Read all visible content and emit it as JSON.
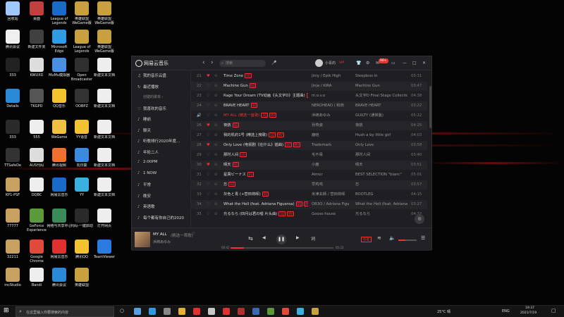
{
  "desktop": {
    "icons": [
      {
        "label": "回收站",
        "color": "#9fc8ff"
      },
      {
        "label": "桌面",
        "color": "#c04040"
      },
      {
        "label": "League of Legends",
        "color": "#1a6ac8"
      },
      {
        "label": "英雄联盟 WeGame版",
        "color": "#c8a040"
      },
      {
        "label": "英雄联盟 WeGame版",
        "color": "#c8a040"
      },
      {
        "label": "腾讯会议",
        "color": "#f0f0f0"
      },
      {
        "label": "新建文件夹",
        "color": "#404040"
      },
      {
        "label": "Microsoft Edge",
        "color": "#2f9be3"
      },
      {
        "label": "League of Legends",
        "color": "#c8a040"
      },
      {
        "label": "英雄联盟 WeGame版",
        "color": "#c8a040"
      },
      {
        "label": "333",
        "color": "#222"
      },
      {
        "label": "KWUXD",
        "color": "#ddd"
      },
      {
        "label": "MuMu模拟器",
        "color": "#4a90e2"
      },
      {
        "label": "Open Broadcaster",
        "color": "#303030"
      },
      {
        "label": "新建文本文档",
        "color": "#eee"
      },
      {
        "label": "Details",
        "color": "#2a8ad8"
      },
      {
        "label": "TKGPD",
        "color": "#555"
      },
      {
        "label": "QQ音乐",
        "color": "#f2c230"
      },
      {
        "label": "OOBPZ",
        "color": "#333"
      },
      {
        "label": "新建文本文档",
        "color": "#eee"
      },
      {
        "label": "333",
        "color": "#2a2a2a"
      },
      {
        "label": "555",
        "color": "#eee"
      },
      {
        "label": "WeGame",
        "color": "#f0c040"
      },
      {
        "label": "YY语音",
        "color": "#f2c230"
      },
      {
        "label": "新建文本文档",
        "color": "#eee"
      },
      {
        "label": "TTSafeDe",
        "color": "#333"
      },
      {
        "label": "AUS代码",
        "color": "#ddd"
      },
      {
        "label": "腾讯视频",
        "color": "#f07030"
      },
      {
        "label": "向日葵",
        "color": "#3a8ae0"
      },
      {
        "label": "新建文本文档",
        "color": "#eee"
      },
      {
        "label": "KP1-PSF",
        "color": "#c8a060"
      },
      {
        "label": "DQBC",
        "color": "#eee"
      },
      {
        "label": "网易云音乐",
        "color": "#1a6ac8"
      },
      {
        "label": "YY",
        "color": "#3ab0e0"
      },
      {
        "label": "新建文本文档",
        "color": "#eee"
      },
      {
        "label": "77777",
        "color": "#c8a060"
      },
      {
        "label": "GeForce Experience",
        "color": "#5a9a3a"
      },
      {
        "label": "网络与共享中心",
        "color": "#3a8a5a"
      },
      {
        "label": "代码-一键启动",
        "color": "#2a2a2a"
      },
      {
        "label": "打开网页",
        "color": "#eee"
      },
      {
        "label": "32211",
        "color": "#c8a060"
      },
      {
        "label": "Google Chrome",
        "color": "#e04a3a"
      },
      {
        "label": "网易云音乐",
        "color": "#e03030"
      },
      {
        "label": "腾讯QQ",
        "color": "#f2c230"
      },
      {
        "label": "TeamViewer",
        "color": "#2a7ae0"
      },
      {
        "label": "mcStudio",
        "color": "#c8a060"
      },
      {
        "label": "Bandi",
        "color": "#eee"
      },
      {
        "label": "腾讯会议",
        "color": "#2a8ad8"
      },
      {
        "label": "英雄联盟",
        "color": "#c8a040"
      }
    ]
  },
  "app": {
    "name": "网易云音乐",
    "search_placeholder": "搜索",
    "user": "小青的",
    "vip_badge": "VIP",
    "msg_count": "99+",
    "nav": {
      "back": "‹",
      "forward": "›"
    },
    "window": {
      "min": "—",
      "max": "□",
      "close": "✕"
    }
  },
  "sidebar": {
    "items": [
      {
        "icon": "♫",
        "label": "我的音乐云盘"
      },
      {
        "icon": "↻",
        "label": "最近播放"
      },
      {
        "icon": "",
        "label": "创建的歌单 ›"
      },
      {
        "icon": "♡",
        "label": "我喜欢的音乐"
      },
      {
        "icon": "♪",
        "label": "睡前"
      },
      {
        "icon": "♪",
        "label": "聊天"
      },
      {
        "icon": "♪",
        "label": "听歌排行2020年度..."
      },
      {
        "icon": "♪",
        "label": "年轮二人"
      },
      {
        "icon": "♪",
        "label": "2:00PM"
      },
      {
        "icon": "♪",
        "label": "1 NOW"
      },
      {
        "icon": "♪",
        "label": "平常"
      },
      {
        "icon": "♪",
        "label": "晚安"
      },
      {
        "icon": "♪",
        "label": "英语歌"
      },
      {
        "icon": "♪",
        "label": "每个都有你自己的2020"
      }
    ]
  },
  "tracks": [
    {
      "num": "21",
      "liked": true,
      "title": "Time Zone",
      "tags": [
        "SQ"
      ],
      "artist": "Jiniy / Epik High",
      "album": "Sleepless in",
      "duration": "03:31"
    },
    {
      "num": "22",
      "liked": false,
      "title": "Machine Gun",
      "tags": [
        "SQ"
      ],
      "artist": "Jinja / KIRA",
      "album": "Machine Gun",
      "duration": "03:47"
    },
    {
      "num": "23",
      "liked": false,
      "title": "Rage Your Dream (TV动画《头文字D》主题曲)",
      "tags": [
        "MV"
      ],
      "artist": "m.o.v.e",
      "album": "头文字D Final Stage Collection",
      "duration": "04:38"
    },
    {
      "num": "24",
      "liked": false,
      "title": "BRAVE HEART",
      "tags": [
        "SQ"
      ],
      "artist": "NERDHEAD / 和田",
      "album": "BRAVE HEART",
      "duration": "03:22"
    },
    {
      "num": "25",
      "liked": false,
      "title": "MY ALL (精选一首歌)",
      "tags": [
        "SQ",
        "MV"
      ],
      "artist": "浜崎あゆみ",
      "album": "GUILTY (通常盤)",
      "duration": "05:22"
    },
    {
      "num": "26",
      "liked": true,
      "title": "夜航",
      "tags": [
        "SQ"
      ],
      "artist": "孙燕姿",
      "album": "夜航",
      "duration": "04:25"
    },
    {
      "num": "27",
      "liked": false,
      "title": "我的机的1号 (精选上榜歌)",
      "tags": [
        "SQ",
        "MV"
      ],
      "artist": "鹿晗",
      "album": "Hush a by little girl",
      "duration": "04:03"
    },
    {
      "num": "28",
      "liked": true,
      "title": "Only Love (电视剧《在什么》插曲)",
      "tags": [
        "SQ",
        "MV"
      ],
      "artist": "Trademark",
      "album": "Only Love",
      "duration": "03:58"
    },
    {
      "num": "29",
      "liked": false,
      "title": "那时人间",
      "tags": [
        "SQ"
      ],
      "artist": "毛不易",
      "album": "那时人间",
      "duration": "03:40"
    },
    {
      "num": "30",
      "liked": true,
      "title": "晴天",
      "tags": [
        "SQ"
      ],
      "artist": "小鹿",
      "album": "晴天",
      "duration": "03:51"
    },
    {
      "num": "31",
      "liked": false,
      "title": "星屑ビーナス",
      "tags": [
        "SQ"
      ],
      "artist": "Aimer",
      "album": "BEST SELECTION \"blanc\"",
      "duration": "05:01"
    },
    {
      "num": "32",
      "liked": false,
      "title": "忘",
      "tags": [
        "SQ"
      ],
      "artist": "早鸡鸡",
      "album": "忘",
      "duration": "03:57"
    },
    {
      "num": "33",
      "liked": false,
      "title": "灰色と青 (+菅田将晖)",
      "tags": [
        "SQ"
      ],
      "artist": "米津玄師 / 菅田将晖",
      "album": "BOOTLEG",
      "duration": "04:15"
    },
    {
      "num": "34",
      "liked": false,
      "title": "What the Hell (feat. Adriana Figueroa)",
      "tags": [
        "SQ",
        "MV"
      ],
      "artist": "OR3O / Adriana Figu",
      "album": "What the Hell (feat. Adriana",
      "duration": "03:27"
    },
    {
      "num": "35",
      "liked": false,
      "title": "光るなら (四月は君の嘘 片头曲)",
      "tags": [
        "SQ",
        "MV"
      ],
      "artist": "Goose house",
      "album": "光るなら",
      "duration": "04:32"
    }
  ],
  "player": {
    "title": "MY ALL",
    "subtitle": "(精选一首歌)",
    "artist": "浜崎あゆみ",
    "elapsed": "00:42",
    "total": "05:22",
    "progress": 0.13,
    "lyrics_label": "词",
    "mode_label": "标准"
  },
  "taskbar": {
    "search_placeholder": "在这里输入你要搜索的内容",
    "weather": "25°C 晴",
    "lang": "ENG",
    "time": "19:37",
    "date": "2021/7/19"
  }
}
